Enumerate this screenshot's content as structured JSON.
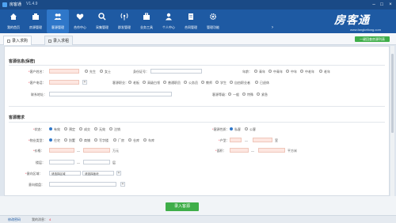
{
  "window": {
    "title": "房客通",
    "version": "V1.4.9"
  },
  "toolbar": {
    "items": [
      {
        "label": "我的首页",
        "icon": "home-icon"
      },
      {
        "label": "房源管理",
        "icon": "house-icon"
      },
      {
        "label": "客源管理",
        "icon": "people-icon"
      },
      {
        "label": "合作中心",
        "icon": "heart-icon"
      },
      {
        "label": "采集管理",
        "icon": "search-icon"
      },
      {
        "label": "群发管理",
        "icon": "broadcast-icon"
      },
      {
        "label": "业务工具",
        "icon": "briefcase-icon"
      },
      {
        "label": "个人中心",
        "icon": "person-icon"
      },
      {
        "label": "合同管理",
        "icon": "contract-icon"
      },
      {
        "label": "管理功能",
        "icon": "gear-icon"
      }
    ],
    "active_index": 2
  },
  "brand": {
    "name": "房客通",
    "url": "www.fangkeitong.com"
  },
  "tabs": [
    {
      "label": "录入求购"
    },
    {
      "label": "录入求租"
    }
  ],
  "new_query_button": "一键回查房源列表",
  "customer_info": {
    "section_title": "客源信息(保密)",
    "name_label": "客户姓名：",
    "gender_options": [
      "先生",
      "女士"
    ],
    "id_label": "身份证号：",
    "age_label": "年龄：",
    "age_options": [
      "青年",
      "中青年",
      "中年",
      "中老年",
      "老年"
    ],
    "phone_label": "客户电话：",
    "job_label": "客源职业：",
    "job_options": [
      "老板",
      "高级白领",
      "普通职员",
      "公务员",
      "教师",
      "学生",
      "自由职业者",
      "已退休"
    ],
    "remark_label": "联系地址：",
    "level_label": "客源等级：",
    "level_options": [
      "一般",
      "特殊",
      "紧急"
    ]
  },
  "requirement": {
    "section_title": "客源需求",
    "status_label": "状态：",
    "status_options": [
      "有效",
      "预定",
      "成交",
      "无效",
      "注销"
    ],
    "nature_label": "客源性质：",
    "nature_options": [
      "私客",
      "公客"
    ],
    "type_label": "物业类型：",
    "type_options": [
      "住宅",
      "别墅",
      "商铺",
      "写字楼",
      "厂房",
      "仓库",
      "车库"
    ],
    "floor_label": "户型：",
    "floor_unit": "室",
    "price_label": "价格：",
    "price_unit": "万元",
    "area_label": "面积：",
    "area_unit": "平方米",
    "layer_label": "楼层：",
    "layer_unit": "层",
    "district_label": "意向区域：",
    "district_select": "请选择区域",
    "plate_select": "请选择板块",
    "community_label": "意向楼盘：",
    "dash": "—"
  },
  "submit_button": "录入客源",
  "status": {
    "left_link": "修改密码",
    "messages": "我的消息：",
    "msg_count": "4"
  }
}
